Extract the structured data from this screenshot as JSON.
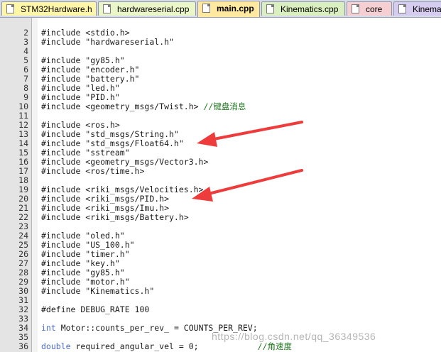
{
  "tabs": [
    {
      "label": "STM32Hardware.h",
      "active": false,
      "bg": "#fff6a8"
    },
    {
      "label": "hardwareserial.cpp",
      "active": false,
      "bg": "#eaf5c8"
    },
    {
      "label": "main.cpp",
      "active": true,
      "bg": "#ffe9a0"
    },
    {
      "label": "Kinematics.cpp",
      "active": false,
      "bg": "#d9efc0"
    },
    {
      "label": "core",
      "active": false,
      "bg": "#f6cfd3"
    },
    {
      "label": "Kinema",
      "active": false,
      "bg": "#d6ccef"
    }
  ],
  "code_lines": [
    {
      "n": "2",
      "type": "inc",
      "text": "#include <stdio.h>"
    },
    {
      "n": "3",
      "type": "inc",
      "text": "#include \"hardwareserial.h\""
    },
    {
      "n": "4",
      "type": "blank",
      "text": ""
    },
    {
      "n": "5",
      "type": "inc",
      "text": "#include \"gy85.h\""
    },
    {
      "n": "6",
      "type": "inc",
      "text": "#include \"encoder.h\""
    },
    {
      "n": "7",
      "type": "inc",
      "text": "#include \"battery.h\""
    },
    {
      "n": "8",
      "type": "inc",
      "text": "#include \"led.h\""
    },
    {
      "n": "9",
      "type": "inc",
      "text": "#include \"PID.h\""
    },
    {
      "n": "10",
      "type": "inc_cm",
      "text": "#include <geometry_msgs/Twist.h>",
      "comment": " //键盘消息"
    },
    {
      "n": "11",
      "type": "blank",
      "text": ""
    },
    {
      "n": "12",
      "type": "inc",
      "text": "#include <ros.h>"
    },
    {
      "n": "13",
      "type": "inc",
      "text": "#include \"std_msgs/String.h\""
    },
    {
      "n": "14",
      "type": "inc",
      "text": "#include \"std_msgs/Float64.h\""
    },
    {
      "n": "15",
      "type": "inc",
      "text": "#include \"sstream\""
    },
    {
      "n": "16",
      "type": "inc",
      "text": "#include <geometry_msgs/Vector3.h>"
    },
    {
      "n": "17",
      "type": "inc",
      "text": "#include <ros/time.h>"
    },
    {
      "n": "18",
      "type": "blank",
      "text": ""
    },
    {
      "n": "19",
      "type": "inc",
      "text": "#include <riki_msgs/Velocities.h>"
    },
    {
      "n": "20",
      "type": "inc",
      "text": "#include <riki_msgs/PID.h>"
    },
    {
      "n": "21",
      "type": "inc",
      "text": "#include <riki_msgs/Imu.h>"
    },
    {
      "n": "22",
      "type": "inc",
      "text": "#include <riki_msgs/Battery.h>"
    },
    {
      "n": "23",
      "type": "blank",
      "text": ""
    },
    {
      "n": "24",
      "type": "inc",
      "text": "#include \"oled.h\""
    },
    {
      "n": "25",
      "type": "inc",
      "text": "#include \"US_100.h\""
    },
    {
      "n": "26",
      "type": "inc",
      "text": "#include \"timer.h\""
    },
    {
      "n": "27",
      "type": "inc",
      "text": "#include \"key.h\""
    },
    {
      "n": "28",
      "type": "inc",
      "text": "#include \"gy85.h\""
    },
    {
      "n": "29",
      "type": "inc",
      "text": "#include \"motor.h\""
    },
    {
      "n": "30",
      "type": "inc",
      "text": "#include \"Kinematics.h\""
    },
    {
      "n": "31",
      "type": "blank",
      "text": ""
    },
    {
      "n": "32",
      "type": "define",
      "text": "#define DEBUG_RATE 100"
    },
    {
      "n": "33",
      "type": "blank",
      "text": ""
    },
    {
      "n": "34",
      "type": "decl",
      "kw": "int",
      "text": " Motor::counts_per_rev_ = COUNTS_PER_REV;"
    },
    {
      "n": "35",
      "type": "blank",
      "text": ""
    },
    {
      "n": "36",
      "type": "decl_cm",
      "kw": "double",
      "text": " required_angular_vel = 0;",
      "comment": "//角速度"
    }
  ],
  "watermark": "https://blog.csdn.net/qq_36349536",
  "colors": {
    "arrow": "#ee3b3b",
    "keyword": "#4b6cc9",
    "comment": "#1f7a1f"
  }
}
